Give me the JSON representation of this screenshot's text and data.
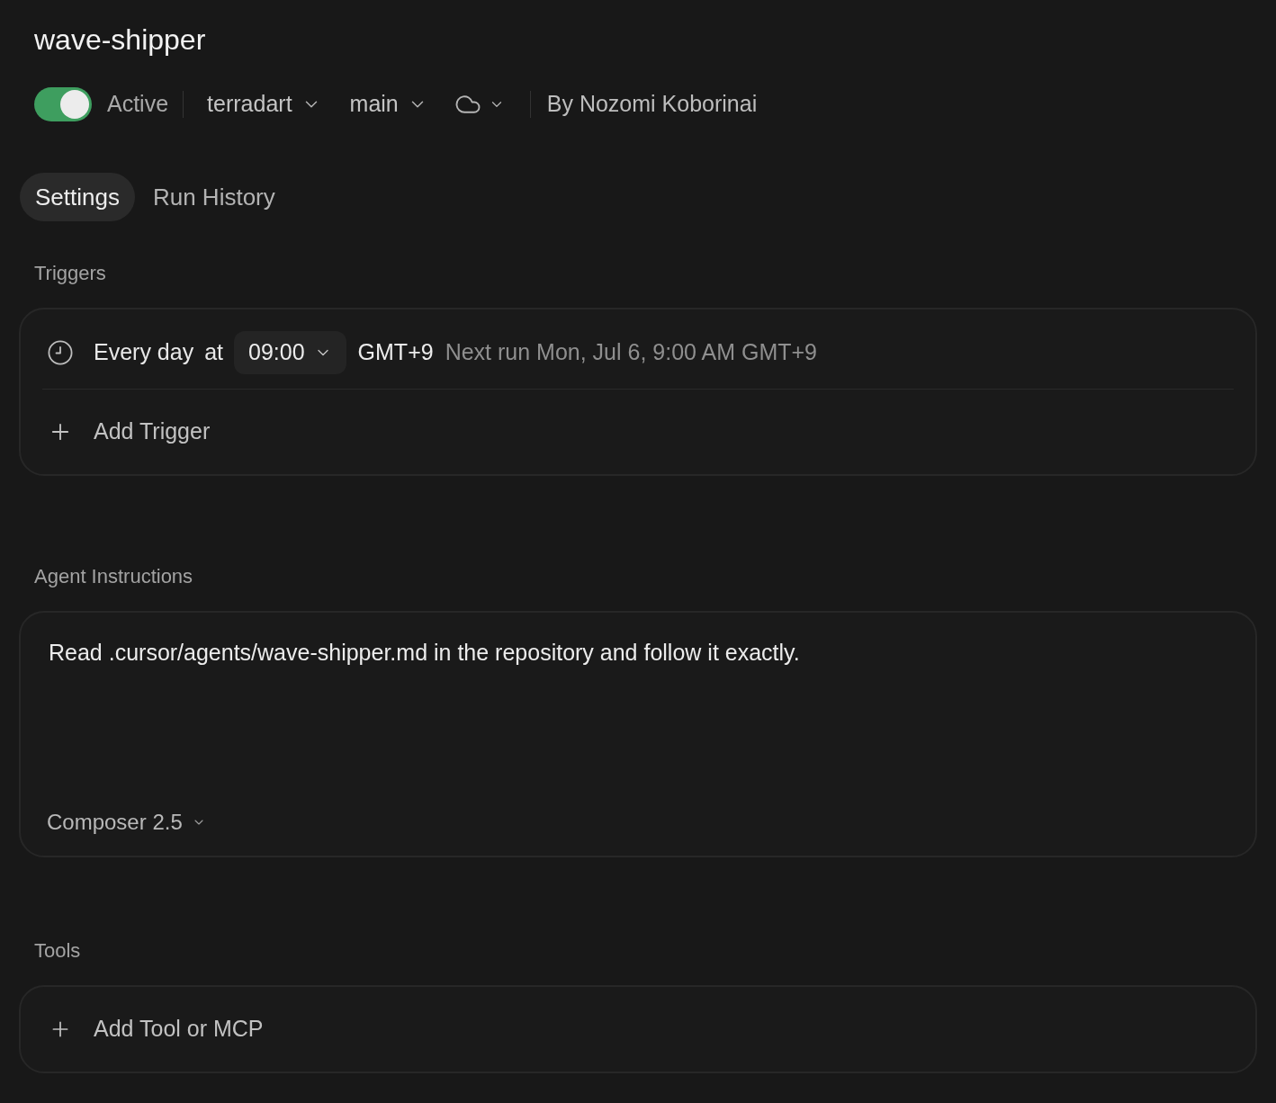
{
  "title": "wave-shipper",
  "header": {
    "active_toggle": {
      "on": true,
      "label": "Active"
    },
    "repo": "terradart",
    "branch": "main",
    "author": "By Nozomi Koborinai"
  },
  "tabs": [
    {
      "label": "Settings",
      "selected": true
    },
    {
      "label": "Run History",
      "selected": false
    }
  ],
  "triggers": {
    "heading": "Triggers",
    "items": [
      {
        "schedule": "Every day",
        "at": "at",
        "time": "09:00",
        "timezone": "GMT+9",
        "next_run": "Next run Mon, Jul 6, 9:00 AM GMT+9"
      }
    ],
    "add_button": "Add Trigger"
  },
  "instructions": {
    "heading": "Agent Instructions",
    "value": "Read .cursor/agents/wave-shipper.md in the repository and follow it exactly.",
    "model": "Composer 2.5"
  },
  "tools": {
    "heading": "Tools",
    "add_button": "Add Tool or MCP"
  }
}
